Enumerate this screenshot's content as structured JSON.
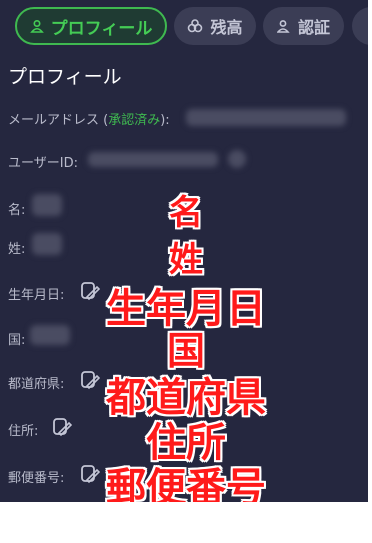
{
  "tabs": [
    {
      "label": "プロフィール",
      "icon": "user-icon",
      "active": true
    },
    {
      "label": "残高",
      "icon": "coins-icon",
      "active": false
    },
    {
      "label": "認証",
      "icon": "user-check-icon",
      "active": false
    }
  ],
  "profile": {
    "title": "プロフィール",
    "email_label_prefix": "メールアドレス (",
    "email_label_status": "承認済み",
    "email_label_suffix": "):",
    "userid_label": "ユーザーID:",
    "first_name_label": "名:",
    "last_name_label": "姓:",
    "birthdate_label": "生年月日:",
    "country_label": "国:",
    "prefecture_label": "都道府県:",
    "address_label": "住所:",
    "postal_label": "郵便番号:"
  },
  "annotations": [
    "名",
    "姓",
    "生年月日",
    "国",
    "都道府県",
    "住所",
    "郵便番号"
  ],
  "colors": {
    "panel_bg": "#25273f",
    "accent_green": "#3fb950",
    "annotation_red": "#ff1a1a"
  }
}
